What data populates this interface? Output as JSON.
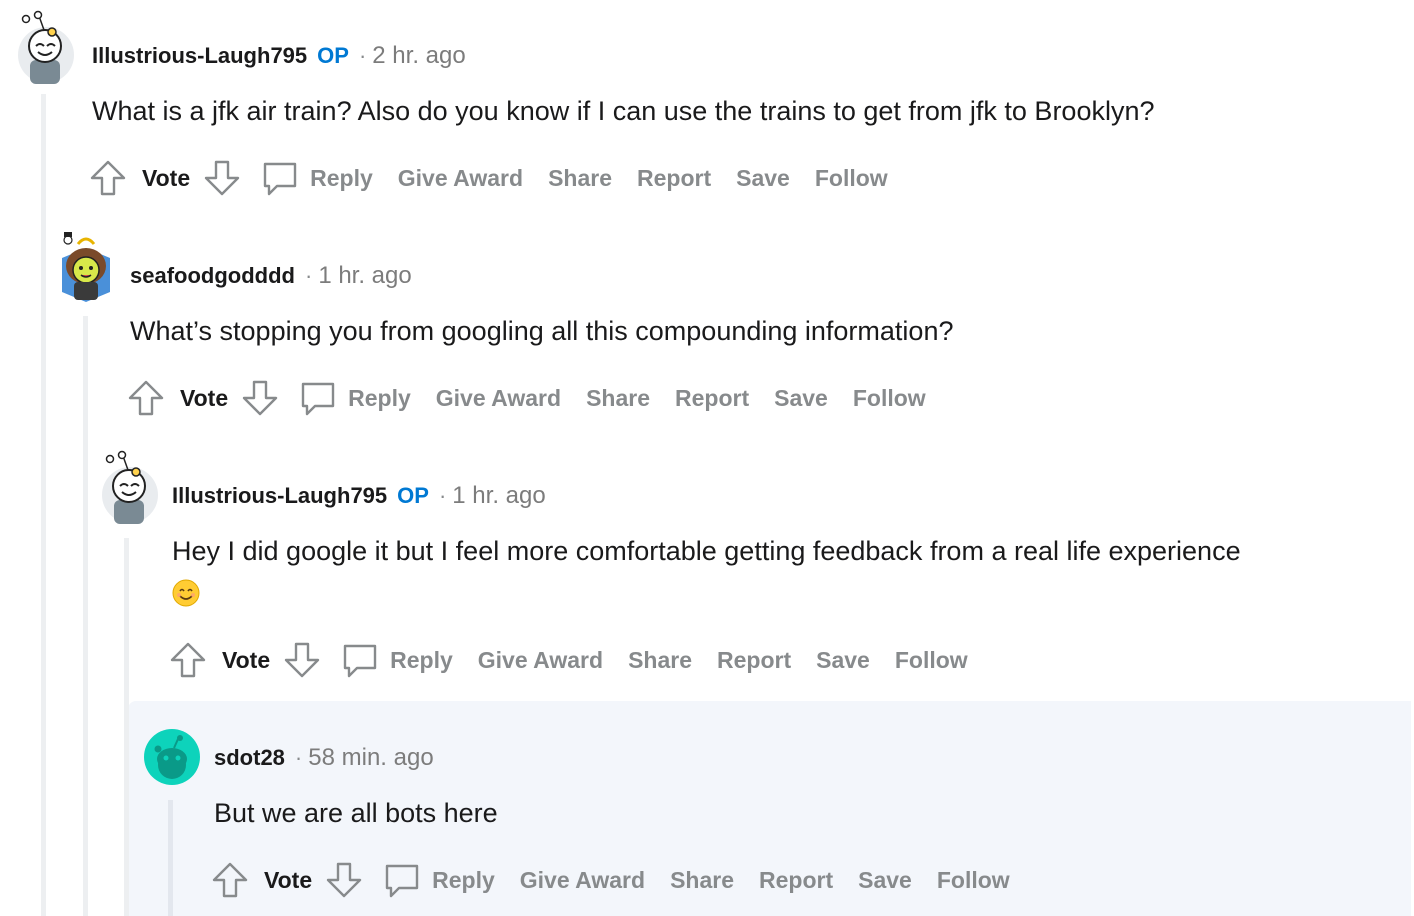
{
  "actions": {
    "vote": "Vote",
    "reply": "Reply",
    "give_award": "Give Award",
    "share": "Share",
    "report": "Report",
    "save": "Save",
    "follow": "Follow"
  },
  "comments": [
    {
      "author": "Illustrious-Laugh795",
      "op_badge": "OP",
      "separator": "·",
      "time": "2 hr. ago",
      "body": "What is a jfk air train? Also do you know if I can use the trains to get from jfk to Brooklyn?",
      "avatar_icon": "snoo-avatar-icon"
    },
    {
      "author": "seafoodgodddd",
      "separator": "·",
      "time": "1 hr. ago",
      "body": "What’s stopping you from googling all this compounding information?",
      "avatar_icon": "snoo-avatar-icon"
    },
    {
      "author": "Illustrious-Laugh795",
      "op_badge": "OP",
      "separator": "·",
      "time": "1 hr. ago",
      "body": "Hey I did google it but I feel more comfortable getting feedback from a real life experience",
      "emoji": "smiling-face-emoji",
      "avatar_icon": "snoo-avatar-icon"
    },
    {
      "author": "sdot28",
      "separator": "·",
      "time": "58 min. ago",
      "body": "But we are all bots here",
      "avatar_icon": "default-snoo-avatar-icon"
    }
  ],
  "colors": {
    "op_blue": "#0079d3",
    "muted_gray": "#878a8c",
    "thread_line": "#edeff1",
    "highlight_bg": "#f3f6fb",
    "default_avatar": "#0dd3bb"
  }
}
